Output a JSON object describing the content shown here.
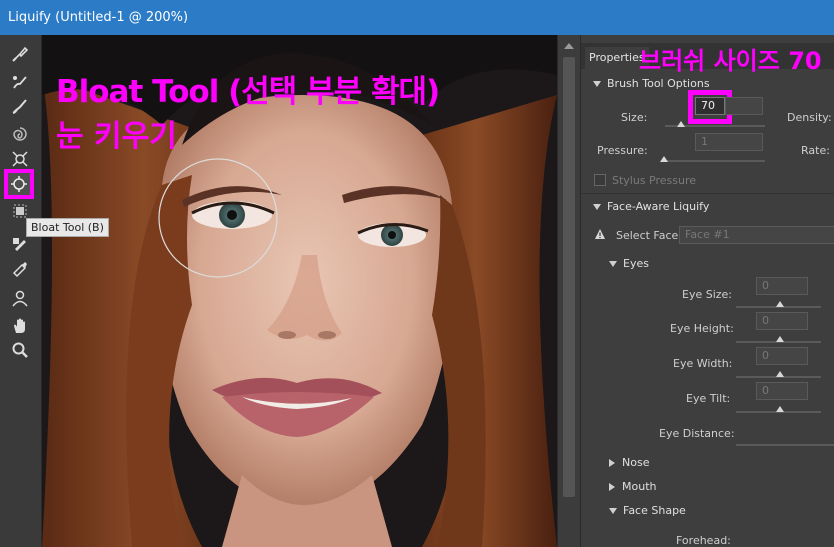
{
  "window": {
    "title": "Liquify (Untitled-1 @ 200%)"
  },
  "annotations": {
    "canvas_line1": "Bloat Tool (선택 부분 확대)",
    "canvas_line2": "눈 키우기",
    "panel_header": "브러쉬 사이즈 70",
    "color": "#ff00ff"
  },
  "toolbar": {
    "tools": [
      {
        "name": "forward-warp-tool-icon"
      },
      {
        "name": "reconstruct-tool-icon"
      },
      {
        "name": "smooth-tool-icon"
      },
      {
        "name": "twirl-clockwise-tool-icon"
      },
      {
        "name": "pucker-tool-icon"
      },
      {
        "name": "bloat-tool-icon",
        "active": true
      },
      {
        "name": "push-left-tool-icon"
      },
      {
        "name": "freeze-mask-tool-icon"
      },
      {
        "name": "thaw-mask-tool-icon"
      },
      {
        "name": "face-tool-icon"
      },
      {
        "name": "hand-tool-icon"
      },
      {
        "name": "zoom-tool-icon"
      }
    ],
    "tooltip": "Bloat Tool (B)"
  },
  "properties": {
    "tab_label": "Properties",
    "brush_tool_options": {
      "header": "Brush Tool Options",
      "size_label": "Size:",
      "size_value": "70",
      "density_label": "Density:",
      "pressure_label": "Pressure:",
      "pressure_value": "1",
      "rate_label": "Rate:",
      "stylus_pressure_label": "Stylus Pressure"
    },
    "face_aware": {
      "header": "Face-Aware Liquify",
      "select_face_label": "Select Face:",
      "select_face_value": "Face #1",
      "eyes": {
        "header": "Eyes",
        "eye_size_label": "Eye Size:",
        "eye_size_value": "0",
        "eye_height_label": "Eye Height:",
        "eye_height_value": "0",
        "eye_width_label": "Eye Width:",
        "eye_width_value": "0",
        "eye_tilt_label": "Eye Tilt:",
        "eye_tilt_value": "0",
        "eye_distance_label": "Eye Distance:"
      },
      "nose_label": "Nose",
      "mouth_label": "Mouth",
      "face_shape_label": "Face Shape",
      "forehead_label": "Forehead:"
    }
  }
}
